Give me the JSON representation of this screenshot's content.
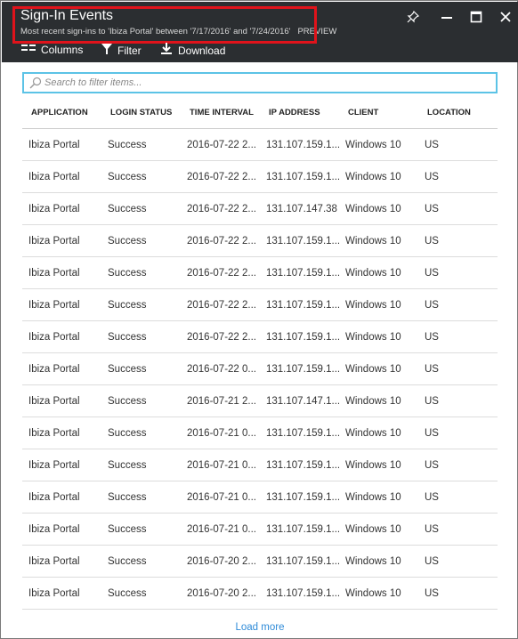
{
  "header": {
    "title": "Sign-In Events",
    "subtitle": "Most recent sign-ins to 'Ibiza Portal' between '7/17/2016' and '7/24/2016'",
    "preview_badge": "PREVIEW"
  },
  "window_controls": [
    "pin-icon",
    "minimize-icon",
    "maximize-icon",
    "close-icon"
  ],
  "toolbar": {
    "columns_label": "Columns",
    "filter_label": "Filter",
    "download_label": "Download"
  },
  "search": {
    "placeholder": "Search to filter items..."
  },
  "table": {
    "columns": [
      "APPLICATION",
      "LOGIN STATUS",
      "TIME INTERVAL",
      "IP ADDRESS",
      "CLIENT",
      "LOCATION"
    ],
    "rows": [
      [
        "Ibiza Portal",
        "Success",
        "2016-07-22 2...",
        "131.107.159.1...",
        "Windows 10",
        "US"
      ],
      [
        "Ibiza Portal",
        "Success",
        "2016-07-22 2...",
        "131.107.159.1...",
        "Windows 10",
        "US"
      ],
      [
        "Ibiza Portal",
        "Success",
        "2016-07-22 2...",
        "131.107.147.38",
        "Windows 10",
        "US"
      ],
      [
        "Ibiza Portal",
        "Success",
        "2016-07-22 2...",
        "131.107.159.1...",
        "Windows 10",
        "US"
      ],
      [
        "Ibiza Portal",
        "Success",
        "2016-07-22 2...",
        "131.107.159.1...",
        "Windows 10",
        "US"
      ],
      [
        "Ibiza Portal",
        "Success",
        "2016-07-22 2...",
        "131.107.159.1...",
        "Windows 10",
        "US"
      ],
      [
        "Ibiza Portal",
        "Success",
        "2016-07-22 2...",
        "131.107.159.1...",
        "Windows 10",
        "US"
      ],
      [
        "Ibiza Portal",
        "Success",
        "2016-07-22 0...",
        "131.107.159.1...",
        "Windows 10",
        "US"
      ],
      [
        "Ibiza Portal",
        "Success",
        "2016-07-21 2...",
        "131.107.147.1...",
        "Windows 10",
        "US"
      ],
      [
        "Ibiza Portal",
        "Success",
        "2016-07-21 0...",
        "131.107.159.1...",
        "Windows 10",
        "US"
      ],
      [
        "Ibiza Portal",
        "Success",
        "2016-07-21 0...",
        "131.107.159.1...",
        "Windows 10",
        "US"
      ],
      [
        "Ibiza Portal",
        "Success",
        "2016-07-21 0...",
        "131.107.159.1...",
        "Windows 10",
        "US"
      ],
      [
        "Ibiza Portal",
        "Success",
        "2016-07-21 0...",
        "131.107.159.1...",
        "Windows 10",
        "US"
      ],
      [
        "Ibiza Portal",
        "Success",
        "2016-07-20 2...",
        "131.107.159.1...",
        "Windows 10",
        "US"
      ],
      [
        "Ibiza Portal",
        "Success",
        "2016-07-20 2...",
        "131.107.159.1...",
        "Windows 10",
        "US"
      ]
    ]
  },
  "load_more_label": "Load more",
  "colors": {
    "header_bg": "#2b2e31",
    "highlight_border": "#e0131b",
    "search_border": "#5cc3e6",
    "link": "#2f8bd8"
  }
}
